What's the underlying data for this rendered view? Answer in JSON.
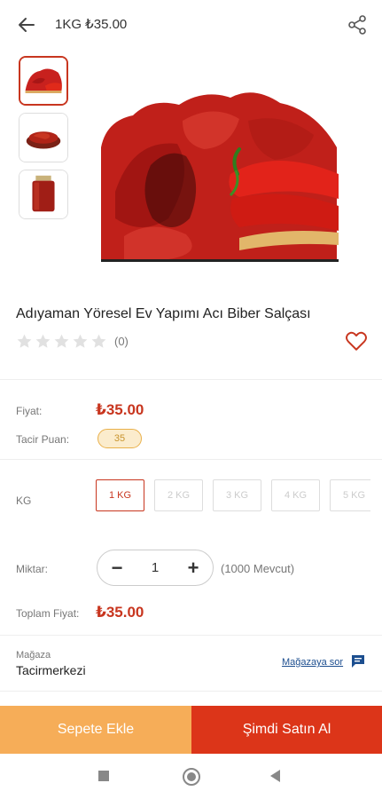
{
  "header": {
    "title": "1KG ₺35.00",
    "back_icon": "arrow-left-icon",
    "share_icon": "share-icon"
  },
  "gallery": {
    "thumbnails": [
      "pepper-paste-pieces",
      "pepper-paste-bowl",
      "pepper-paste-jar"
    ],
    "selected_index": 0
  },
  "product": {
    "title": "Adıyaman Yöresel Ev Yapımı Acı Biber Salçası",
    "rating_stars": 0,
    "rating_max": 5,
    "rating_count": "(0)"
  },
  "pricing": {
    "price_label": "Fiyat:",
    "price_value": "₺35.00",
    "points_label": "Tacir Puan:",
    "points_value": "35"
  },
  "variants": {
    "label": "KG",
    "options": [
      "1 KG",
      "2 KG",
      "3 KG",
      "4 KG",
      "5 KG"
    ],
    "selected": "1 KG"
  },
  "quantity": {
    "label": "Miktar:",
    "minus": "−",
    "value": "1",
    "plus": "+",
    "stock": "(1000 Mevcut)"
  },
  "total": {
    "label": "Toplam Fiyat:",
    "value": "₺35.00"
  },
  "store": {
    "label": "Mağaza",
    "name": "Tacirmerkezi",
    "ask_link": "Mağazaya sor"
  },
  "actions": {
    "add_to_cart": "Sepete Ekle",
    "buy_now": "Şimdi Satın Al"
  },
  "colors": {
    "accent": "#c8361f",
    "cart_button": "#f6ad58",
    "buy_button": "#dc3519",
    "store_link": "#1c4e8f"
  }
}
